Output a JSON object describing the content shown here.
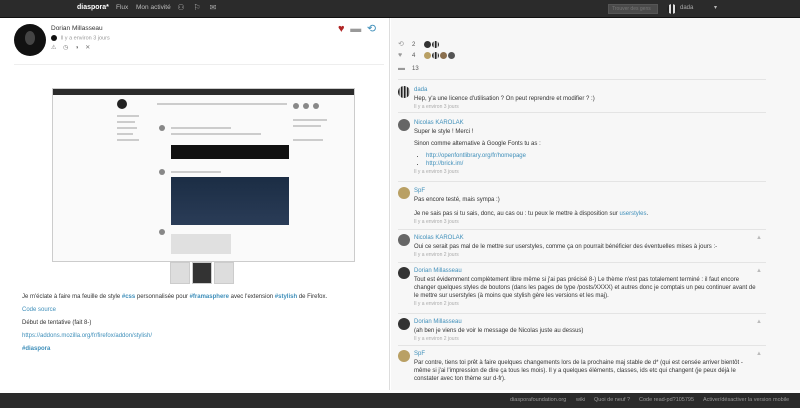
{
  "header": {
    "brand": "diaspora*",
    "nav_stream": "Flux",
    "nav_activity": "Mon activité",
    "search_placeholder": "Trouver des gens",
    "user_name": "dada"
  },
  "post": {
    "author": "Dorian Millasseau",
    "time": "Il y a environ 3 jours",
    "body": {
      "p1_pre": "Je m'éclate à faire ma feuille de style ",
      "p1_tag1": "#css",
      "p1_mid": " personnalisée pour ",
      "p1_tag2": "#framasphere",
      "p1_mid2": " avec l'extension ",
      "p1_tag3": "#stylish",
      "p1_post": " de Firefox.",
      "source_link": "Code source",
      "draft": "Début de tentative (fait 8-)",
      "addon_link": "https://addons.mozilla.org/fr/firefox/addon/stylish/",
      "final_tag": "#diaspora"
    }
  },
  "stats": {
    "reshares": "2",
    "likes": "4",
    "comments": "13"
  },
  "comments": [
    {
      "author": "dada",
      "text": "Hep, y'a une licence d'utilisation ? On peut reprendre et modifier ? :)",
      "time": "Il y a environ 3 jours",
      "avatar_color": "#999"
    },
    {
      "author": "Nicolas KAROLAK",
      "text": "Super le style ! Merci !",
      "text2": "Sinon comme alternative à Google Fonts tu as :",
      "links": [
        "http://openfontlibrary.org/fr/homepage",
        "http://brick.im/"
      ],
      "time": "Il y a environ 3 jours",
      "avatar_color": "#666"
    },
    {
      "author": "SpF",
      "text": "Pas encore testé, mais sympa :)",
      "text2_pre": "Je ne sais pas si tu sais, donc, au cas ou : tu peux le mettre à disposition sur ",
      "text2_link": "userstyles",
      "text2_post": ".",
      "time": "Il y a environ 3 jours",
      "avatar_color": "#b9a064"
    },
    {
      "author": "Nicolas KAROLAK",
      "text": "Oui ce serait pas mal de le mettre sur userstyles, comme ça on pourrait bénéficier des éventuelles mises à jours :-",
      "time": "Il y a environ 2 jours",
      "avatar_color": "#666"
    },
    {
      "author": "Dorian Millasseau",
      "text": "Tout est évidemment complètement libre même si j'ai pas précisé 8-) Le thème n'est pas totalement terminé : il faut encore changer quelques styles de boutons (dans les pages de type /posts/XXXX) et autres donc je comptais un peu continuer avant de le mettre sur userstyles (à moins que stylish gère les versions et les maj).",
      "time": "Il y a environ 2 jours",
      "avatar_color": "#111"
    },
    {
      "author": "Dorian Millasseau",
      "text": "(ah ben je viens de voir le message de Nicolas juste au dessus)",
      "time": "Il y a environ 2 jours",
      "avatar_color": "#111"
    },
    {
      "author": "SpF",
      "text": "Par contre, tiens toi prêt à faire quelques changements lors de la prochaine maj stable de d* (qui est censée arriver bientôt - même si j'ai l'impression de dire ça tous les mois). Il y a quelques éléments, classes, ids etc qui changent (je peux déjà le constater avec ton thème sur d-fr).",
      "time": "",
      "avatar_color": "#b9a064"
    }
  ],
  "footer": {
    "site": "diasporafoundation.org",
    "wiki": "wiki",
    "whats_new": "Quoi de neuf ?",
    "code": "Code read-pd?105795",
    "mobile": "Activer/désactiver la version mobile"
  }
}
